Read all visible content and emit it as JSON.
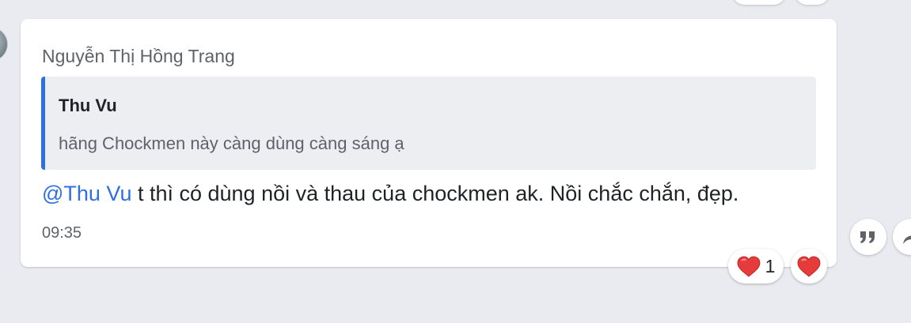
{
  "message": {
    "sender": "Nguyễn Thị Hồng Trang",
    "quote": {
      "author": "Thu Vu",
      "text": "hãng Chockmen này càng dùng càng sáng ạ"
    },
    "mention": "@Thu Vu",
    "body": " t thì có dùng nồi và thau của chockmen ak. Nồi chắc chắn, đẹp.",
    "time": "09:35",
    "reactions": [
      {
        "icon": "heart-icon",
        "count": "1"
      }
    ],
    "accent_color": "#2f6fe4"
  },
  "actions": [
    {
      "name": "quote-icon"
    },
    {
      "name": "forward-icon"
    }
  ]
}
